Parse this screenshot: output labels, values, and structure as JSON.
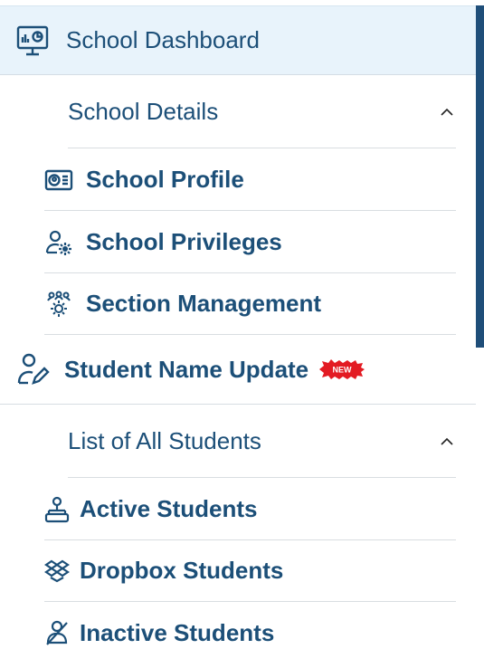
{
  "nav": {
    "dashboard": {
      "label": "School Dashboard",
      "icon": "dashboard-monitor-icon"
    },
    "school_details": {
      "label": "School Details",
      "expanded": true,
      "items": [
        {
          "label": "School Profile",
          "icon": "id-card-icon"
        },
        {
          "label": "School Privileges",
          "icon": "user-settings-icon"
        },
        {
          "label": "Section Management",
          "icon": "team-gear-icon"
        }
      ]
    },
    "student_name_update": {
      "label": "Student Name Update",
      "badge": "NEW",
      "icon": "user-edit-icon"
    },
    "students": {
      "label": "List of All Students",
      "expanded": true,
      "items": [
        {
          "label": "Active Students",
          "icon": "student-hierarchy-icon"
        },
        {
          "label": "Dropbox Students",
          "icon": "dropbox-icon"
        },
        {
          "label": "Inactive Students",
          "icon": "user-inactive-icon"
        }
      ]
    }
  },
  "colors": {
    "text": "#1c4f78",
    "active_bg": "#e8f3fb",
    "badge": "#e31b23",
    "scrollbar": "#1f4e79"
  }
}
